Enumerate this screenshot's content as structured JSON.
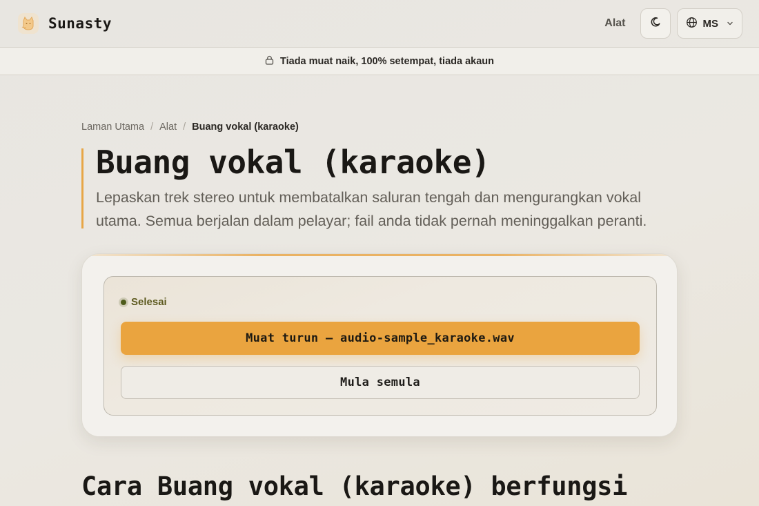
{
  "header": {
    "brand_name": "Sunasty",
    "nav_tools": "Alat",
    "theme_icon": "moon-icon",
    "language": "MS"
  },
  "banner": {
    "text": "Tiada muat naik, 100% setempat, tiada akaun",
    "icon": "lock-icon"
  },
  "breadcrumb": {
    "home": "Laman Utama",
    "separator": "/",
    "tools": "Alat",
    "current": "Buang vokal (karaoke)"
  },
  "hero": {
    "title": "Buang vokal (karaoke)",
    "description": "Lepaskan trek stereo untuk membatalkan saluran tengah dan mengurangkan vokal utama. Semua berjalan dalam pelayar; fail anda tidak pernah meninggalkan peranti."
  },
  "tool": {
    "status": "Selesai",
    "download_label": "Muat turun — audio-sample_karaoke.wav",
    "reset_label": "Mula semula"
  },
  "section": {
    "title": "Cara Buang vokal (karaoke) berfungsi"
  },
  "colors": {
    "accent": "#eaa43f",
    "status_dot": "#4d5b1b",
    "background": "#e8e6e1"
  }
}
